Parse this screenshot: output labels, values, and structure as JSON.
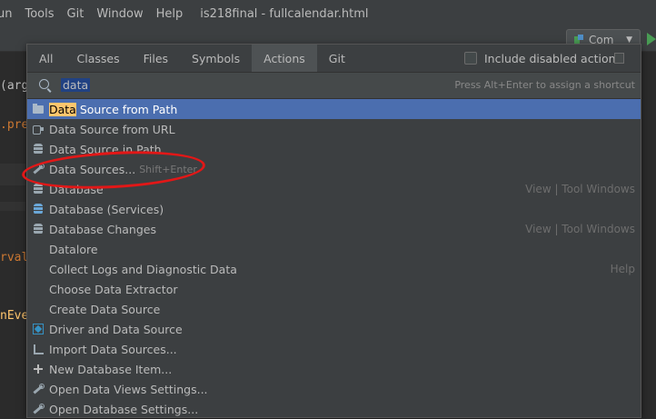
{
  "menubar": {
    "items": [
      "un",
      "Tools",
      "Git",
      "Window",
      "Help"
    ],
    "file_title": "is218final - fullcalendar.html"
  },
  "toolbar": {
    "run_config_label": "Com"
  },
  "editor": {
    "snippets": [
      "(arg",
      ".pre",
      "rval",
      "nEve"
    ]
  },
  "popup": {
    "tabs": [
      "All",
      "Classes",
      "Files",
      "Symbols",
      "Actions",
      "Git"
    ],
    "active_tab": "Actions",
    "include_disabled_label": "Include disabled actions",
    "search_value": "data",
    "shortcut_hint": "Press Alt+Enter to assign a shortcut",
    "results": [
      {
        "label_match": "Data",
        "label_rest": " Source from Path",
        "icon": "folder-icon",
        "selected": true,
        "shortcut": "",
        "group": ""
      },
      {
        "label_match": "",
        "label_rest": "Data Source from URL",
        "icon": "url-icon",
        "selected": false,
        "shortcut": "",
        "group": ""
      },
      {
        "label_match": "",
        "label_rest": "Data Source in Path",
        "icon": "database-icon",
        "selected": false,
        "shortcut": "",
        "group": ""
      },
      {
        "label_match": "",
        "label_rest": "Data Sources...",
        "icon": "data-sources-wrench-icon",
        "selected": false,
        "shortcut": "Shift+Enter",
        "group": ""
      },
      {
        "label_match": "",
        "label_rest": "Database",
        "icon": "database-icon",
        "selected": false,
        "shortcut": "",
        "group": "View | Tool Windows"
      },
      {
        "label_match": "",
        "label_rest": "Database (Services)",
        "icon": "database-services-icon",
        "selected": false,
        "shortcut": "",
        "group": ""
      },
      {
        "label_match": "",
        "label_rest": "Database Changes",
        "icon": "database-changes-icon",
        "selected": false,
        "shortcut": "",
        "group": "View | Tool Windows"
      },
      {
        "label_match": "",
        "label_rest": "Datalore",
        "icon": "",
        "selected": false,
        "shortcut": "",
        "group": ""
      },
      {
        "label_match": "",
        "label_rest": "Collect Logs and Diagnostic Data",
        "icon": "",
        "selected": false,
        "shortcut": "",
        "group": "Help"
      },
      {
        "label_match": "",
        "label_rest": "Choose Data Extractor",
        "icon": "",
        "selected": false,
        "shortcut": "",
        "group": ""
      },
      {
        "label_match": "",
        "label_rest": "Create Data Source",
        "icon": "",
        "selected": false,
        "shortcut": "",
        "group": ""
      },
      {
        "label_match": "",
        "label_rest": "Driver and Data Source",
        "icon": "driver-icon",
        "selected": false,
        "shortcut": "",
        "group": ""
      },
      {
        "label_match": "",
        "label_rest": "Import Data Sources...",
        "icon": "import-icon",
        "selected": false,
        "shortcut": "",
        "group": ""
      },
      {
        "label_match": "",
        "label_rest": "New Database Item...",
        "icon": "plus-icon",
        "selected": false,
        "shortcut": "",
        "group": ""
      },
      {
        "label_match": "",
        "label_rest": "Open Data Views Settings...",
        "icon": "wrench-icon",
        "selected": false,
        "shortcut": "",
        "group": ""
      },
      {
        "label_match": "",
        "label_rest": "Open Database Settings...",
        "icon": "wrench-icon",
        "selected": false,
        "shortcut": "",
        "group": ""
      }
    ]
  },
  "colors": {
    "selection": "#4b6eaf",
    "match_highlight": "#ffc66d",
    "annotation_circle": "#e21717"
  }
}
